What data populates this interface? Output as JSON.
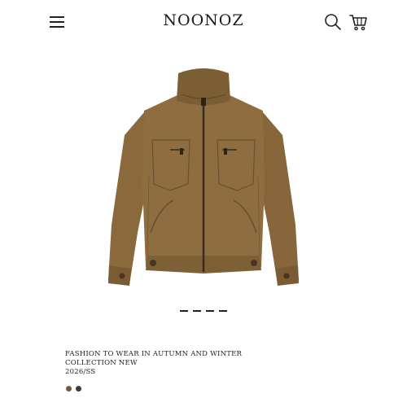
{
  "header": {
    "brand": "NOONOZ",
    "menu_icon": "hamburger-menu-icon",
    "search_icon": "search-icon",
    "cart_icon": "shopping-cart-icon"
  },
  "product": {
    "image_icon": "brown-zip-jacket-image",
    "jacket_color": "#8a6a3c",
    "title_line1": "FASHION TO WEAR IN AUTUMN AND WINTER",
    "title_line2": "COLLECTION NEW",
    "season": "2026/SS",
    "swatches": [
      {
        "color": "#7a5a36"
      },
      {
        "color": "#3b3b3b"
      }
    ]
  },
  "carousel": {
    "slide_count": 4
  }
}
